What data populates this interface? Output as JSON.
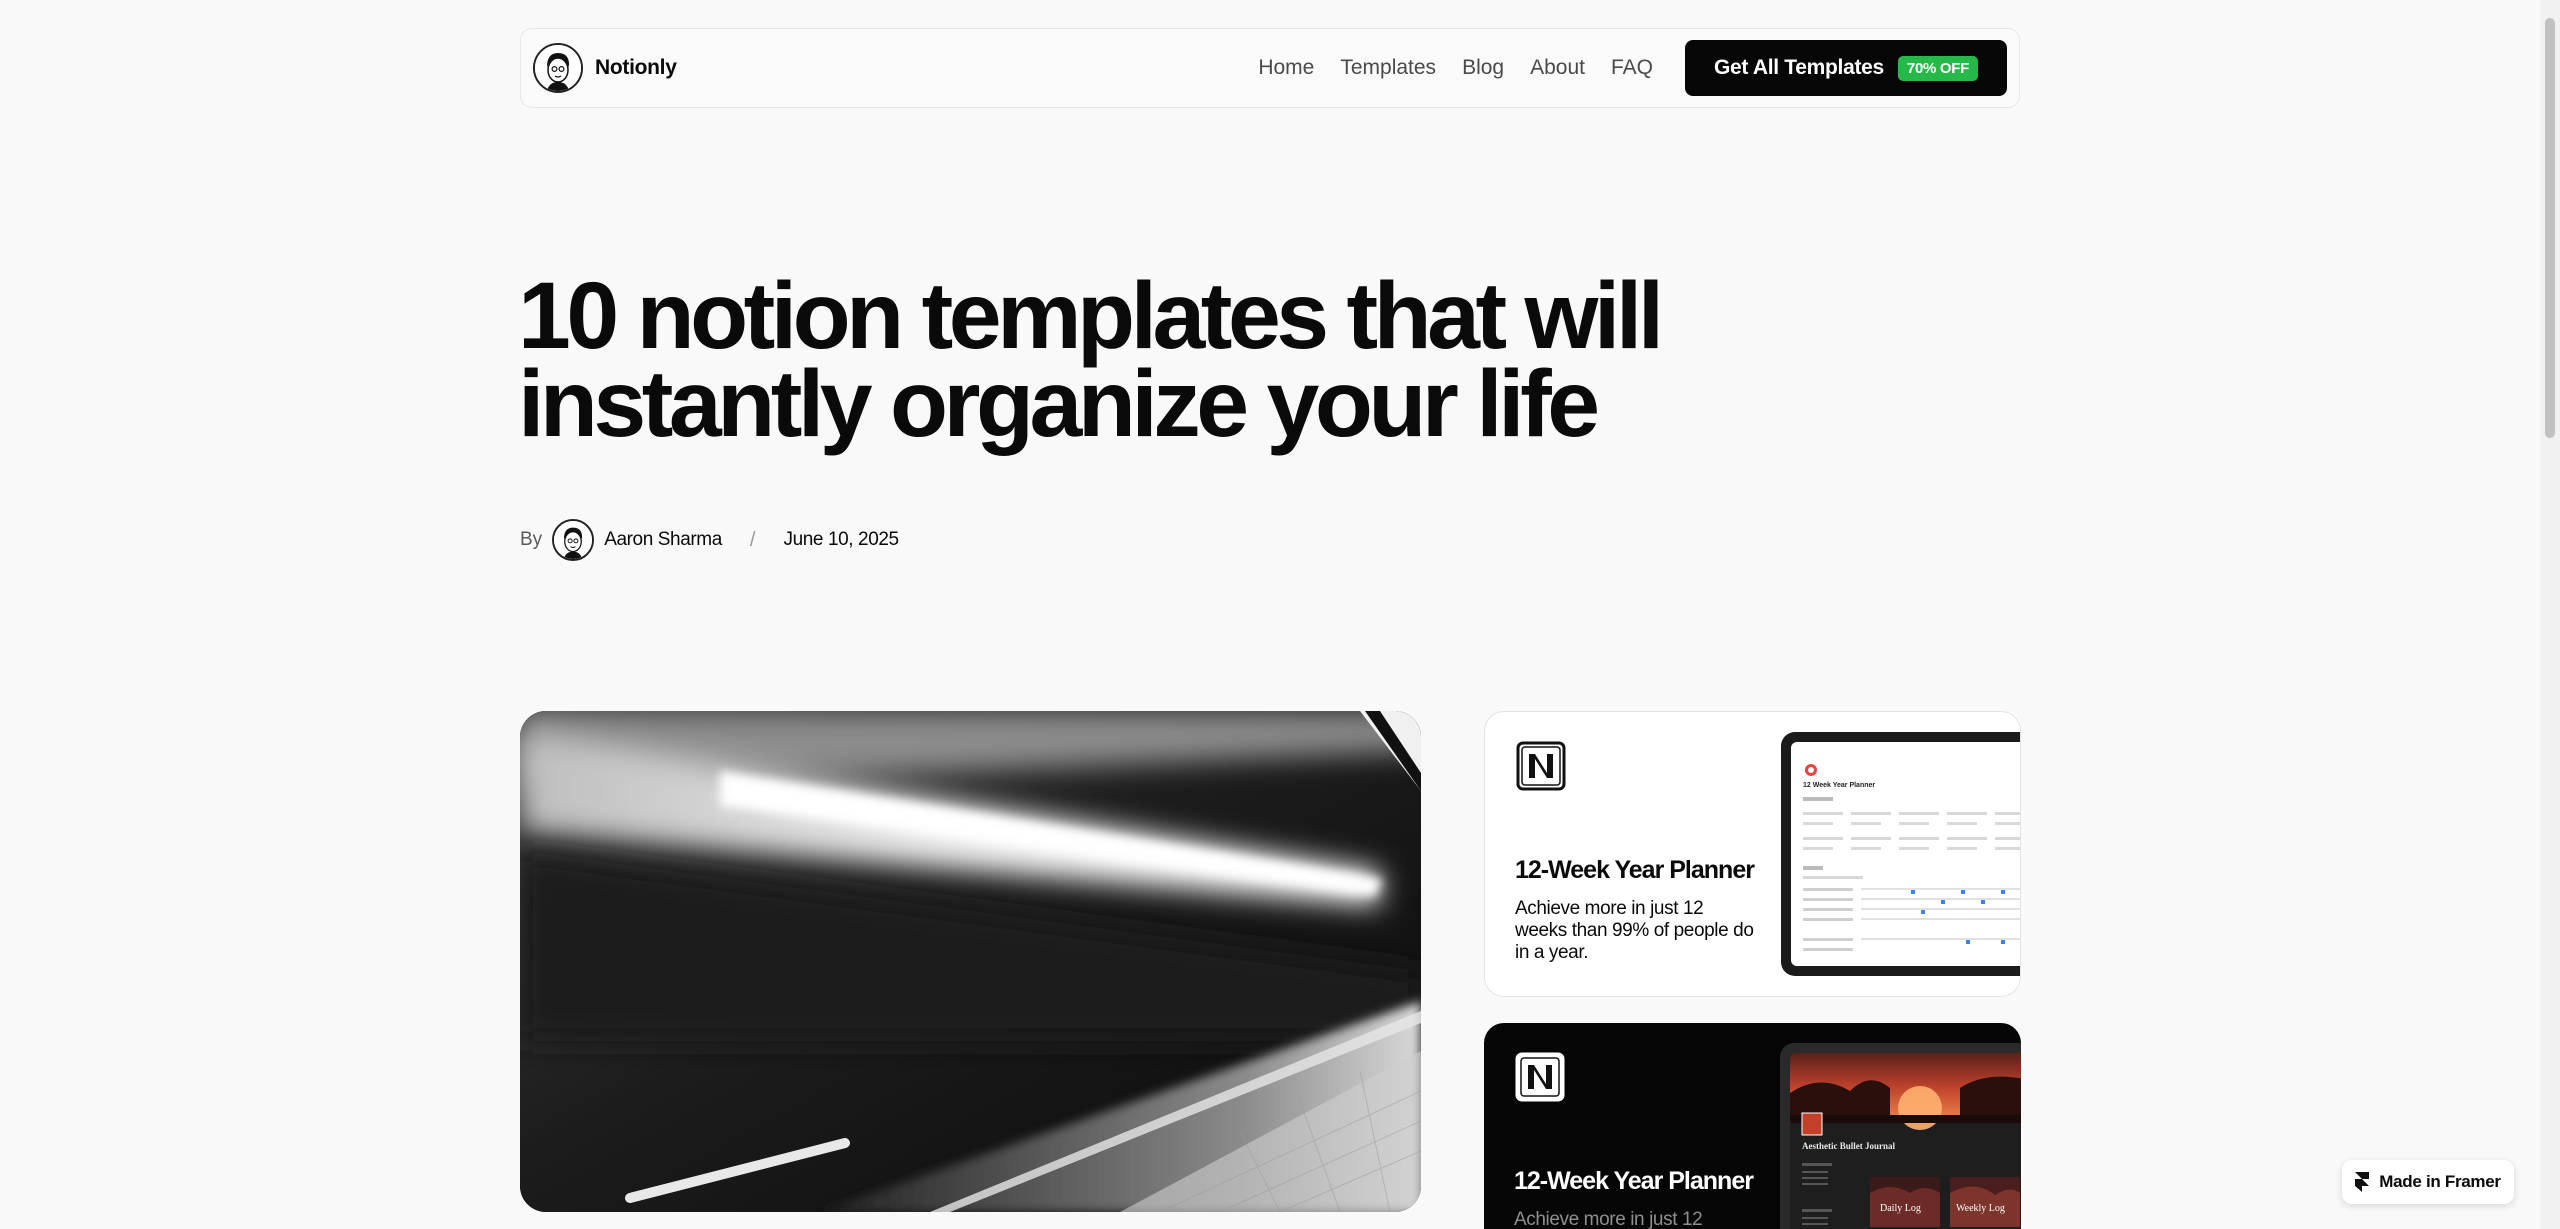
{
  "nav": {
    "brand": "Notionly",
    "links": [
      "Home",
      "Templates",
      "Blog",
      "About",
      "FAQ"
    ],
    "cta_label": "Get All Templates",
    "cta_badge": "70% OFF"
  },
  "post": {
    "title": "10 notion templates that will instantly organize your life",
    "by": "By",
    "author": "Aaron Sharma",
    "separator": "/",
    "date": "June 10, 2025"
  },
  "cards": [
    {
      "title": "12-Week Year Planner",
      "description": "Achieve more in just 12 weeks than 99% of people do in a year.",
      "preview_title": "12 Week Year Planner"
    },
    {
      "title": "12-Week Year Planner",
      "description": "Achieve more in just 12",
      "preview_title": "Aesthetic Bullet Journal",
      "preview_tiles": [
        "Daily Log",
        "Weekly Log"
      ]
    }
  ],
  "framer_badge": "Made in Framer",
  "colors": {
    "background": "#f9f9f9",
    "cta": "#070707",
    "badge": "#27b84a"
  }
}
